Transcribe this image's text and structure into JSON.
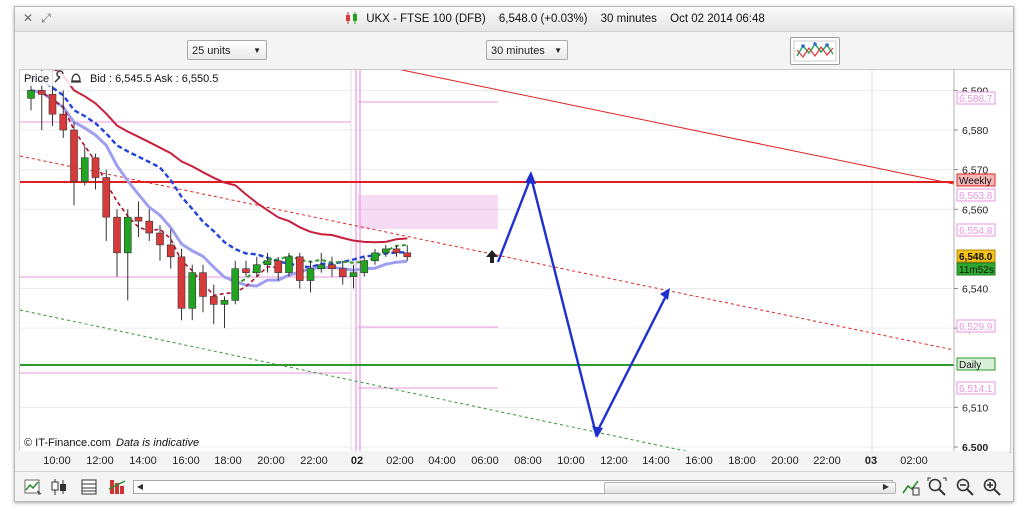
{
  "window": {
    "controls": [
      "✕",
      "⤢"
    ],
    "title": {
      "symbol": "UKX - FTSE 100 (DFB)",
      "quote": "6,548.0 (+0.03%)",
      "interval": "30 minutes",
      "datetime": "Oct 02 2014 06:48"
    }
  },
  "toolbar": {
    "units_select": "25 units",
    "interval_select": "30 minutes",
    "pattern_icon": "pattern-chart-icon"
  },
  "chart": {
    "header": {
      "price_label": "Price",
      "bid_ask": "Bid : 6,545.5 Ask : 6,550.5"
    },
    "footer_credit": "© IT-Finance.com",
    "footer_note": "Data is indicative",
    "price_axis": {
      "ticks": [
        "6,500",
        "6,510",
        "6,530",
        "6,540",
        "6,560",
        "6,570",
        "6,580",
        "6,590"
      ],
      "tick_values": [
        6500,
        6510,
        6530,
        6540,
        6560,
        6570,
        6580,
        6590
      ],
      "min": 6500,
      "max": 6590,
      "level_labels": [
        {
          "text": "6,588.7",
          "kind": "pink"
        },
        {
          "text": "Weekly",
          "kind": "red"
        },
        {
          "text": "6,563.8",
          "kind": "pink"
        },
        {
          "text": "6,554.8",
          "kind": "pink"
        },
        {
          "text": "6,548.0",
          "kind": "last"
        },
        {
          "text": "11m52s",
          "kind": "timer"
        },
        {
          "text": "6,529.9",
          "kind": "pink"
        },
        {
          "text": "Daily",
          "kind": "green"
        },
        {
          "text": "6,514.1",
          "kind": "pink"
        }
      ]
    },
    "time_axis": [
      "10:00",
      "12:00",
      "14:00",
      "16:00",
      "18:00",
      "20:00",
      "22:00",
      "02",
      "02:00",
      "04:00",
      "06:00",
      "08:00",
      "10:00",
      "12:00",
      "14:00",
      "16:00",
      "18:00",
      "20:00",
      "22:00",
      "03",
      "02:00"
    ],
    "colors": {
      "bull": "#22a322",
      "bear": "#d83a3a",
      "weekly": "#e02020",
      "daily": "#2e9a2e",
      "pivot": "#e896e0",
      "ma_red": "#c81e3c",
      "ma_blue": "#2244dd",
      "ma_lilac": "#9f9ff0",
      "projection": "#1f2fd0"
    }
  },
  "chart_data": {
    "type": "candlestick",
    "title": "UKX - FTSE 100 (DFB)",
    "interval": "30 minutes",
    "ylim": [
      6500,
      6590
    ],
    "weekly_level": 6567,
    "daily_level": 6520,
    "pivot_levels": [
      6588.7,
      6563.8,
      6554.8,
      6529.9,
      6514.1
    ],
    "last_price": 6548.0,
    "candles": [
      {
        "o": 6588,
        "h": 6594,
        "l": 6585,
        "c": 6590
      },
      {
        "o": 6590,
        "h": 6596,
        "l": 6580,
        "c": 6589
      },
      {
        "o": 6589,
        "h": 6595,
        "l": 6581,
        "c": 6584
      },
      {
        "o": 6584,
        "h": 6590,
        "l": 6578,
        "c": 6580
      },
      {
        "o": 6580,
        "h": 6582,
        "l": 6561,
        "c": 6567
      },
      {
        "o": 6567,
        "h": 6576,
        "l": 6566,
        "c": 6573
      },
      {
        "o": 6573,
        "h": 6574,
        "l": 6565,
        "c": 6568
      },
      {
        "o": 6568,
        "h": 6570,
        "l": 6552,
        "c": 6558
      },
      {
        "o": 6558,
        "h": 6560,
        "l": 6543,
        "c": 6549
      },
      {
        "o": 6549,
        "h": 6560,
        "l": 6537,
        "c": 6558
      },
      {
        "o": 6558,
        "h": 6562,
        "l": 6553,
        "c": 6557
      },
      {
        "o": 6557,
        "h": 6560,
        "l": 6552,
        "c": 6554
      },
      {
        "o": 6554,
        "h": 6556,
        "l": 6547,
        "c": 6551
      },
      {
        "o": 6551,
        "h": 6555,
        "l": 6545,
        "c": 6548
      },
      {
        "o": 6548,
        "h": 6550,
        "l": 6532,
        "c": 6535
      },
      {
        "o": 6535,
        "h": 6546,
        "l": 6532,
        "c": 6544
      },
      {
        "o": 6544,
        "h": 6546,
        "l": 6534,
        "c": 6538
      },
      {
        "o": 6538,
        "h": 6541,
        "l": 6531,
        "c": 6536
      },
      {
        "o": 6536,
        "h": 6538,
        "l": 6530,
        "c": 6537
      },
      {
        "o": 6537,
        "h": 6547,
        "l": 6536,
        "c": 6545
      },
      {
        "o": 6545,
        "h": 6547,
        "l": 6543,
        "c": 6544
      },
      {
        "o": 6544,
        "h": 6548,
        "l": 6543,
        "c": 6546
      },
      {
        "o": 6546,
        "h": 6549,
        "l": 6544,
        "c": 6547
      },
      {
        "o": 6547,
        "h": 6548,
        "l": 6542,
        "c": 6544
      },
      {
        "o": 6544,
        "h": 6549,
        "l": 6543,
        "c": 6548
      },
      {
        "o": 6548,
        "h": 6549,
        "l": 6540,
        "c": 6542
      },
      {
        "o": 6542,
        "h": 6547,
        "l": 6539,
        "c": 6545
      },
      {
        "o": 6545,
        "h": 6549,
        "l": 6544,
        "c": 6546
      },
      {
        "o": 6546,
        "h": 6548,
        "l": 6543,
        "c": 6545
      },
      {
        "o": 6545,
        "h": 6547,
        "l": 6541,
        "c": 6543
      },
      {
        "o": 6543,
        "h": 6546,
        "l": 6540,
        "c": 6544
      },
      {
        "o": 6544,
        "h": 6548,
        "l": 6543,
        "c": 6547
      },
      {
        "o": 6547,
        "h": 6550,
        "l": 6546,
        "c": 6549
      },
      {
        "o": 6549,
        "h": 6551,
        "l": 6548,
        "c": 6550
      },
      {
        "o": 6550,
        "h": 6551,
        "l": 6548,
        "c": 6549
      },
      {
        "o": 6549,
        "h": 6551,
        "l": 6547,
        "c": 6548
      }
    ],
    "projection_path": [
      {
        "label": "06:00",
        "price": 6549
      },
      {
        "label": "08:00",
        "price": 6570
      },
      {
        "label": "11:00",
        "price": 6504
      },
      {
        "label": "14:00",
        "price": 6537
      }
    ]
  },
  "bottombar": {
    "icons": [
      "chart-type-icon",
      "candle-style-icon",
      "table-icon",
      "indicator-icon",
      "draw-tools-icon",
      "zoom-fit-icon",
      "zoom-out-icon",
      "zoom-in-icon"
    ]
  }
}
